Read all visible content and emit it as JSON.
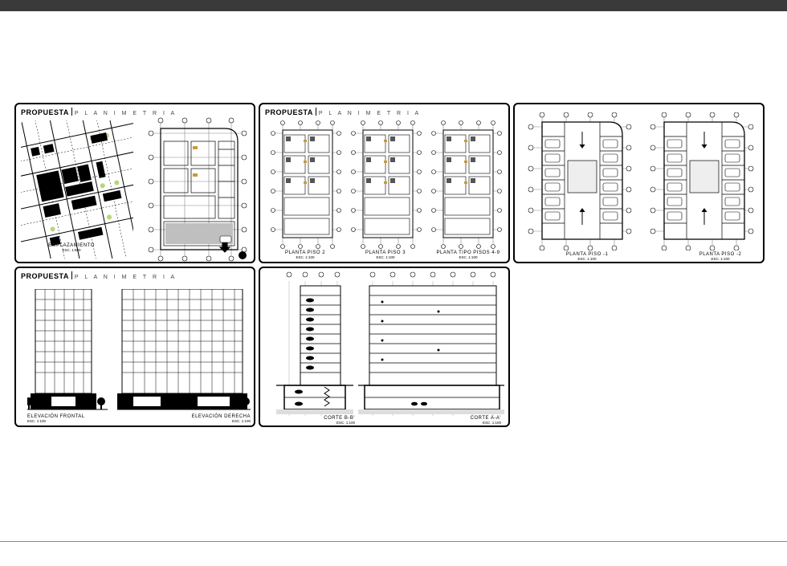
{
  "doc": {
    "title_prefix": "PROPUESTA",
    "title_suffix": "P L A N I M E T R I A"
  },
  "panels": {
    "p1": {
      "cap1": "EMPLAZAMIENTO",
      "sc1": "ESC. 1:500"
    },
    "p2": {
      "cap1": "PLANTA PISO 2",
      "sc1": "ESC. 1:100",
      "cap2": "PLANTA PISO 3",
      "sc2": "ESC. 1:100",
      "cap3": "PLANTA TIPO PISOS 4-9",
      "sc3": "ESC. 1:100"
    },
    "p3": {
      "cap1": "PLANTA PISO -1",
      "sc1": "ESC. 1:100",
      "cap2": "PLANTA PISO -2",
      "sc2": "ESC. 1:100"
    },
    "p4": {
      "cap1": "ELEVACIÓN FRONTAL",
      "sc1": "ESC. 1:100",
      "cap2": "ELEVACIÓN DERECHA",
      "sc2": "ESC. 1:100"
    },
    "p5": {
      "cap1": "CORTE B-B'",
      "sc1": "ESC. 1:100",
      "cap2": "CORTE A-A'",
      "sc2": "ESC. 1:100"
    }
  }
}
